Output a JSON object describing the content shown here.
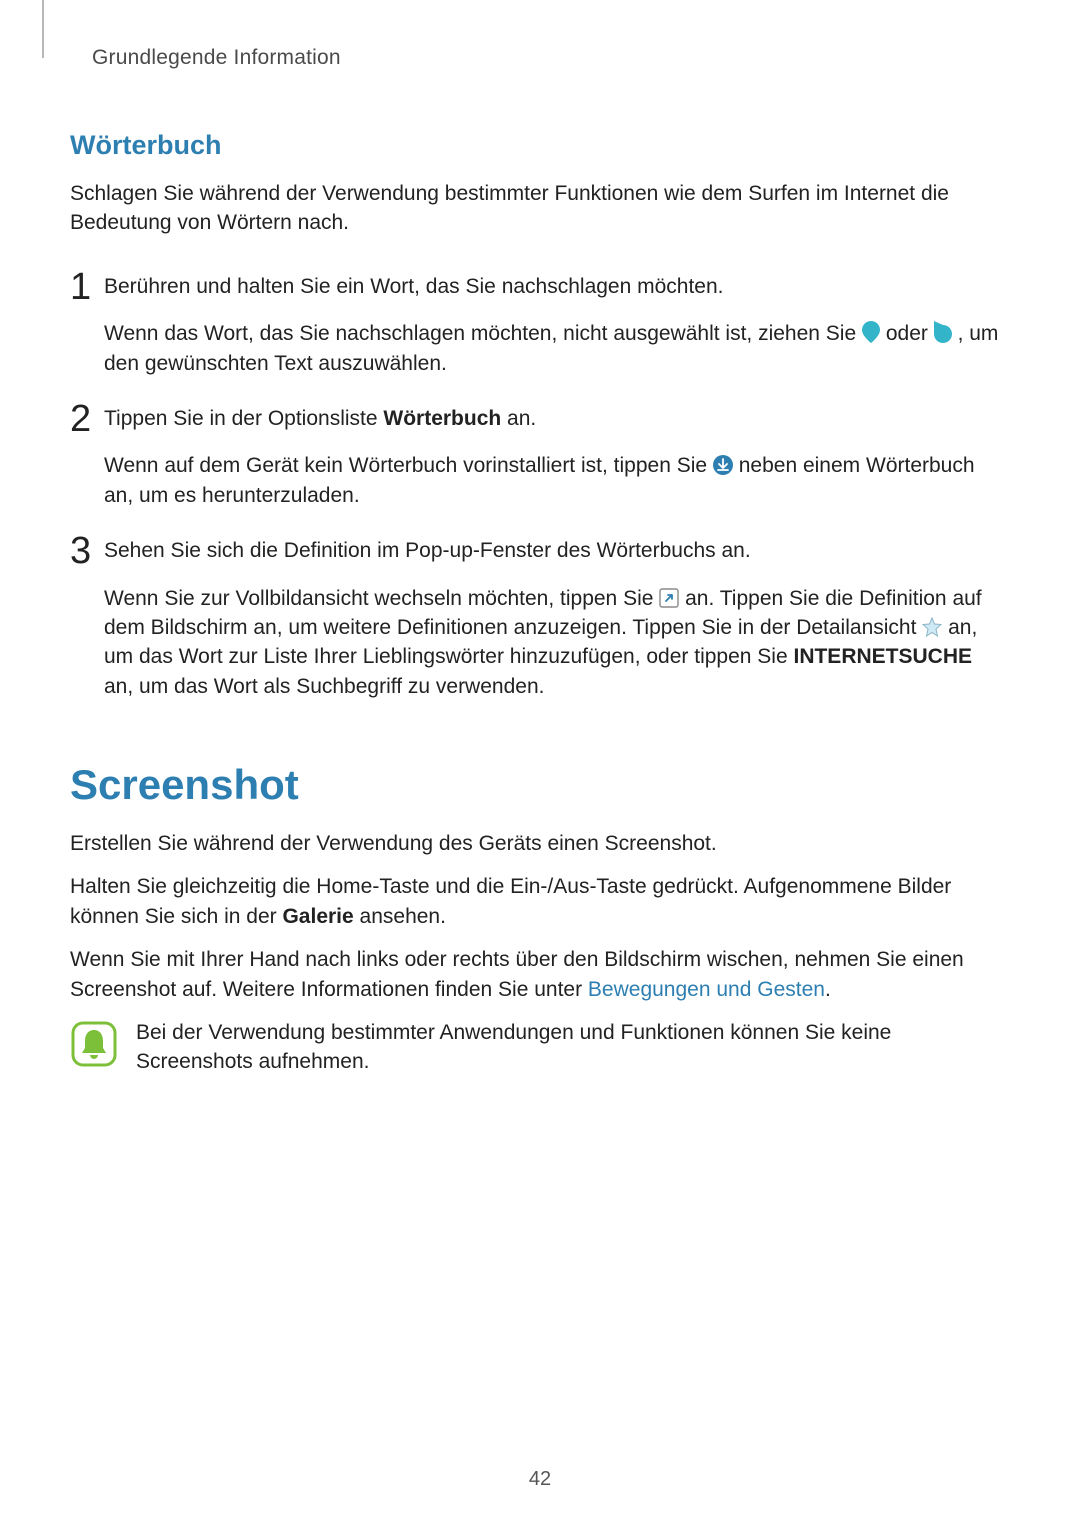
{
  "header": {
    "running_head": "Grundlegende Information"
  },
  "dictionary_section": {
    "title": "Wörterbuch",
    "intro": "Schlagen Sie während der Verwendung bestimmter Funktionen wie dem Surfen im Internet die Bedeutung von Wörtern nach.",
    "steps": [
      {
        "num": "1",
        "lead": "Berühren und halten Sie ein Wort, das Sie nachschlagen möchten.",
        "detail_pre": "Wenn das Wort, das Sie nachschlagen möchten, nicht ausgewählt ist, ziehen Sie ",
        "detail_mid": " oder ",
        "detail_post": ", um den gewünschten Text auszuwählen."
      },
      {
        "num": "2",
        "lead_pre": "Tippen Sie in der Optionsliste ",
        "lead_bold": "Wörterbuch",
        "lead_post": " an.",
        "detail_pre": "Wenn auf dem Gerät kein Wörterbuch vorinstalliert ist, tippen Sie ",
        "detail_post": " neben einem Wörterbuch an, um es herunterzuladen."
      },
      {
        "num": "3",
        "lead": "Sehen Sie sich die Definition im Pop-up-Fenster des Wörterbuchs an.",
        "detail_pre": "Wenn Sie zur Vollbildansicht wechseln möchten, tippen Sie ",
        "detail_mid1": " an. Tippen Sie die Definition auf dem Bildschirm an, um weitere Definitionen anzuzeigen. Tippen Sie in der Detailansicht ",
        "detail_mid2": " an, um das Wort zur Liste Ihrer Lieblingswörter hinzuzufügen, oder tippen Sie ",
        "detail_bold": "INTERNETSUCHE",
        "detail_post": " an, um das Wort als Suchbegriff zu verwenden."
      }
    ]
  },
  "screenshot_section": {
    "title": "Screenshot",
    "p1": "Erstellen Sie während der Verwendung des Geräts einen Screenshot.",
    "p2_pre": "Halten Sie gleichzeitig die Home-Taste und die Ein-/Aus-Taste gedrückt. Aufgenommene Bilder können Sie sich in der ",
    "p2_bold": "Galerie",
    "p2_post": " ansehen.",
    "p3_pre": "Wenn Sie mit Ihrer Hand nach links oder rechts über den Bildschirm wischen, nehmen Sie einen Screenshot auf. Weitere Informationen finden Sie unter ",
    "p3_link": "Bewegungen und Gesten",
    "p3_post": ".",
    "note": "Bei der Verwendung bestimmter Anwendungen und Funktionen können Sie keine Screenshots aufnehmen."
  },
  "page_number": "42"
}
